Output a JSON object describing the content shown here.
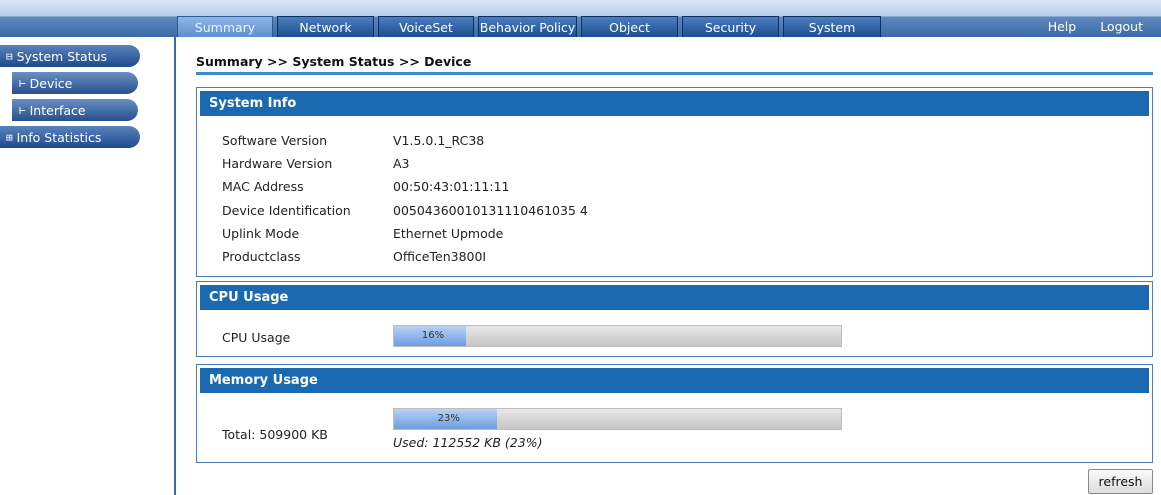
{
  "nav": {
    "tabs": [
      "Summary",
      "Network",
      "VoiceSet",
      "Behavior Policy",
      "Object",
      "Security",
      "System"
    ],
    "active_tab": "Summary",
    "help": "Help",
    "logout": "Logout"
  },
  "sidebar": {
    "system_status": {
      "glyph": "⊟",
      "label": "System Status"
    },
    "device": {
      "glyph": "⊢",
      "label": "Device"
    },
    "interface": {
      "glyph": "⊢",
      "label": "Interface"
    },
    "info_statistics": {
      "glyph": "⊞",
      "label": "Info Statistics"
    }
  },
  "breadcrumb": "Summary >> System Status >> Device",
  "system_info": {
    "title": "System Info",
    "rows": [
      {
        "label": "Software Version",
        "value": "V1.5.0.1_RC38"
      },
      {
        "label": "Hardware Version",
        "value": "A3"
      },
      {
        "label": "MAC Address",
        "value": "00:50:43:01:11:11"
      },
      {
        "label": "Device Identification",
        "value": "00504360010131110461035 4"
      },
      {
        "label": "Uplink Mode",
        "value": "Ethernet Upmode"
      },
      {
        "label": "Productclass",
        "value": "OfficeTen3800I"
      }
    ]
  },
  "cpu": {
    "title": "CPU Usage",
    "label": "CPU Usage",
    "percent": 16,
    "percent_text": "16%"
  },
  "memory": {
    "title": "Memory Usage",
    "total_label": "Total: 509900 KB",
    "percent": 23,
    "percent_text": "23%",
    "used_text": "Used: 112552 KB (23%)"
  },
  "refresh_label": "refresh",
  "colors": {
    "panel_header": "#1b6ab1",
    "nav_bar": "#3b6aa8",
    "bar_fill": "#6c9ee0"
  }
}
